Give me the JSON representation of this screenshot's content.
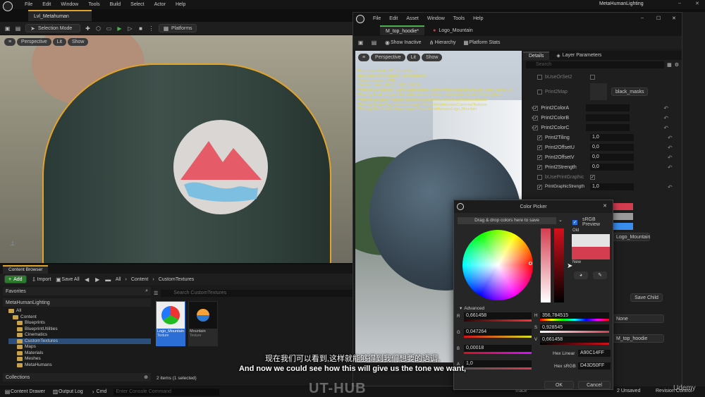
{
  "menubar": {
    "items": [
      "File",
      "Edit",
      "Window",
      "Tools",
      "Build",
      "Select",
      "Actor",
      "Help"
    ],
    "project_name": "MetaHumanLighting"
  },
  "main_tab": "Lvl_Metahuman",
  "toolbar": {
    "selection_mode": "Selection Mode",
    "platforms": "Platforms"
  },
  "viewport_bar": {
    "perspective": "Perspective",
    "lit": "Lit",
    "show": "Show"
  },
  "content_browser": {
    "tab": "Content Browser",
    "add": "Add",
    "import": "Import",
    "save_all": "Save All",
    "path": [
      "All",
      "Content",
      "CustomTextures"
    ],
    "favorites": "Favorites",
    "project_root": "MetaHumanLighting",
    "tree": [
      "All",
      "Content",
      "Blueprints",
      "BlueprintUtilities",
      "Cinematics",
      "CustomTextures",
      "Maps",
      "Materials",
      "Meshes",
      "MetaHumans"
    ],
    "search_placeholder": "Search CustomTextures",
    "assets": [
      {
        "name": "Logo_Mountain",
        "type": "Texture"
      },
      {
        "name": "Mountain",
        "type": "Texture"
      }
    ],
    "status": "2 items (1 selected)",
    "collections": "Collections"
  },
  "bottom_bar": {
    "content_drawer": "Content Drawer",
    "output_log": "Output Log",
    "cmd": "Cmd",
    "console_placeholder": "Enter Console Command",
    "trace": "Trace",
    "unsaved": "2 Unsaved",
    "revision": "Revision Control"
  },
  "material_editor": {
    "menu": [
      "File",
      "Edit",
      "Asset",
      "Window",
      "Tools",
      "Help"
    ],
    "tabs": [
      "M_top_hoodie*",
      "Logo_Mountain"
    ],
    "toolbar": {
      "show_inactive": "Show Inactive",
      "hierarchy": "Hierarchy",
      "platform_stats": "Platform Stats"
    },
    "viewport_bar": {
      "perspective": "Perspective",
      "lit": "Lit",
      "show": "Show"
    },
    "stats": [
      "Base pass shader: 351 instructions",
      "Base pass vertex shader: 129 instructions",
      "Texture samplers: 9/16",
      "Texture Lookups (Est.): VS(0), PS(15)",
      "Warning: AO samples /Game/MetaHumans/Common/Materials/booleanMask_Apple_Alpha_13",
      "Warning: Mask samples /Game/MetaHumans/Common/Materials/boolMaskOutput_Metal",
      "Warning: DetailTex_Variation samples /Game/MetaHumans/Common/Materials/",
      "Warning: MasterTex_Variation samples /Game/MetaHumans/Common/Textures",
      "Warning: PrintGraphicMap samples /Game/MetaHumans/Logo_Mountain"
    ],
    "details_tab": "Details",
    "layer_tab": "Layer Parameters",
    "search_placeholder": "Search",
    "params": [
      {
        "name": "bUseOrSet2",
        "kind": "check"
      },
      {
        "name": "Print2Map",
        "kind": "texture",
        "value": "black_masks"
      },
      {
        "name": "Print2ColorA",
        "kind": "color"
      },
      {
        "name": "Print2ColorB",
        "kind": "color"
      },
      {
        "name": "Print2ColorC",
        "kind": "color"
      },
      {
        "name": "Print2Tiling",
        "kind": "num",
        "value": "1,0"
      },
      {
        "name": "Print2OffsetU",
        "kind": "num",
        "value": "0,0"
      },
      {
        "name": "Print2OffsetV",
        "kind": "num",
        "value": "0,0"
      },
      {
        "name": "Print2Strength",
        "kind": "num",
        "value": "0,0"
      },
      {
        "name": "bUsePrintGraphic",
        "kind": "check"
      },
      {
        "name": "PrintGraphicStrength",
        "kind": "num",
        "value": "1,0"
      }
    ],
    "texture_name": "Logo_Mountain",
    "parent": "M_top_hoodie",
    "add_child": "Save Child",
    "none": "None"
  },
  "color_picker": {
    "title": "Color Picker",
    "drop_hint": "Drag & drop colors here to save",
    "srgb_preview": "sRGB Preview",
    "old_label": "Old",
    "new_label": "New",
    "advanced": "Advanced",
    "r": "0,661458",
    "g": "0,047264",
    "b": "0,00018",
    "a": "1,0",
    "h": "356,784515",
    "s": "0,928545",
    "v": "0,661458",
    "hex_linear_label": "Hex Linear",
    "hex_linear": "A90C14FF",
    "hex_srgb_label": "Hex sRGB",
    "hex_srgb": "D43D50FF",
    "ok": "OK",
    "cancel": "Cancel",
    "colors": {
      "old": "#e4e4e4",
      "new": "#d43d50"
    }
  },
  "subtitles": {
    "zh": "现在我们可以看到,这样就能够得到我们想要的语调,",
    "en": "And now we could see how this will give us the tone we want,"
  },
  "watermark": "UT-HUB",
  "udemy": "Udemy"
}
